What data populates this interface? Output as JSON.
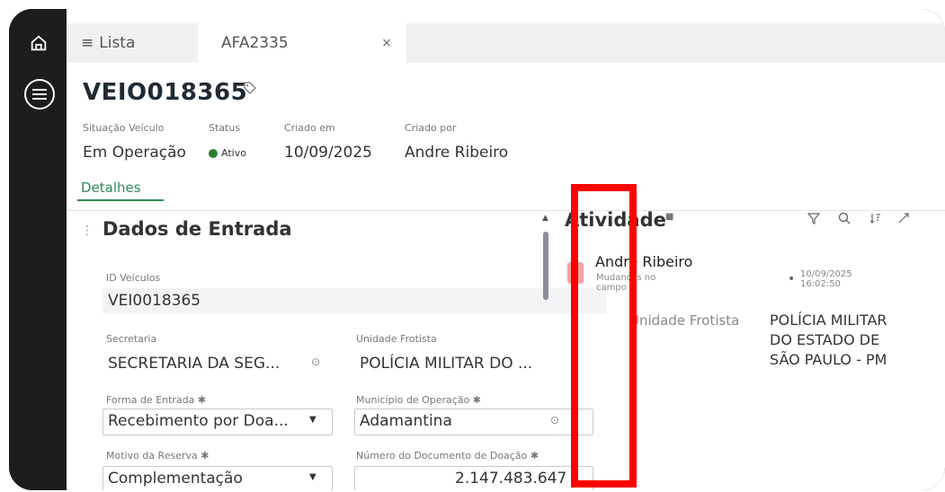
{
  "tabs": {
    "list_label": "Lista",
    "record_label": "AFA2335",
    "close_glyph": "×"
  },
  "record": {
    "code": "VEIO018365",
    "meta": [
      {
        "label": "Situação Veículo",
        "value": "Em Operação"
      },
      {
        "label": "Status",
        "value": "Ativo"
      },
      {
        "label": "Criado em",
        "value": "10/09/2025"
      },
      {
        "label": "Criado por",
        "value": "Andre Ribeiro"
      }
    ],
    "details_tab": "Detalhes"
  },
  "section": {
    "title": "Dados de Entrada",
    "fields": {
      "id_veiculo": {
        "label": "ID Veículos",
        "value": "VEI0018365"
      },
      "secretaria": {
        "label": "Secretaria",
        "value": "SECRETARIA DA SEG..."
      },
      "unidade_frotista": {
        "label": "Unidade Frotista",
        "value": "POLÍCIA MILITAR DO ..."
      },
      "forma_entrada": {
        "label": "Forma de Entrada ✱",
        "value": "Recebimento por Doa..."
      },
      "municipio": {
        "label": "Município de Operação ✱",
        "value": "Adamantina"
      },
      "motivo_reserva": {
        "label": "Motivo da Reserva ✱",
        "value": "Complementação"
      },
      "numero_doc": {
        "label": "Número do Documento de Doação ✱",
        "value": "2.147.483.647"
      }
    }
  },
  "activity": {
    "title": "Atividade",
    "entry": {
      "user": "Andre Ribeiro",
      "subtitle": "Mudanças no campo",
      "timestamp_date": "10/09/2025",
      "timestamp_time": "16:02:50",
      "field": "Unidade Frotista",
      "new_value": "POLÍCIA MILITAR DO ESTADO DE SÃO PAULO - PM"
    }
  },
  "colors": {
    "status_active": "#2e7d32",
    "accent": "#2e8b57",
    "highlight": "#ff0000"
  }
}
